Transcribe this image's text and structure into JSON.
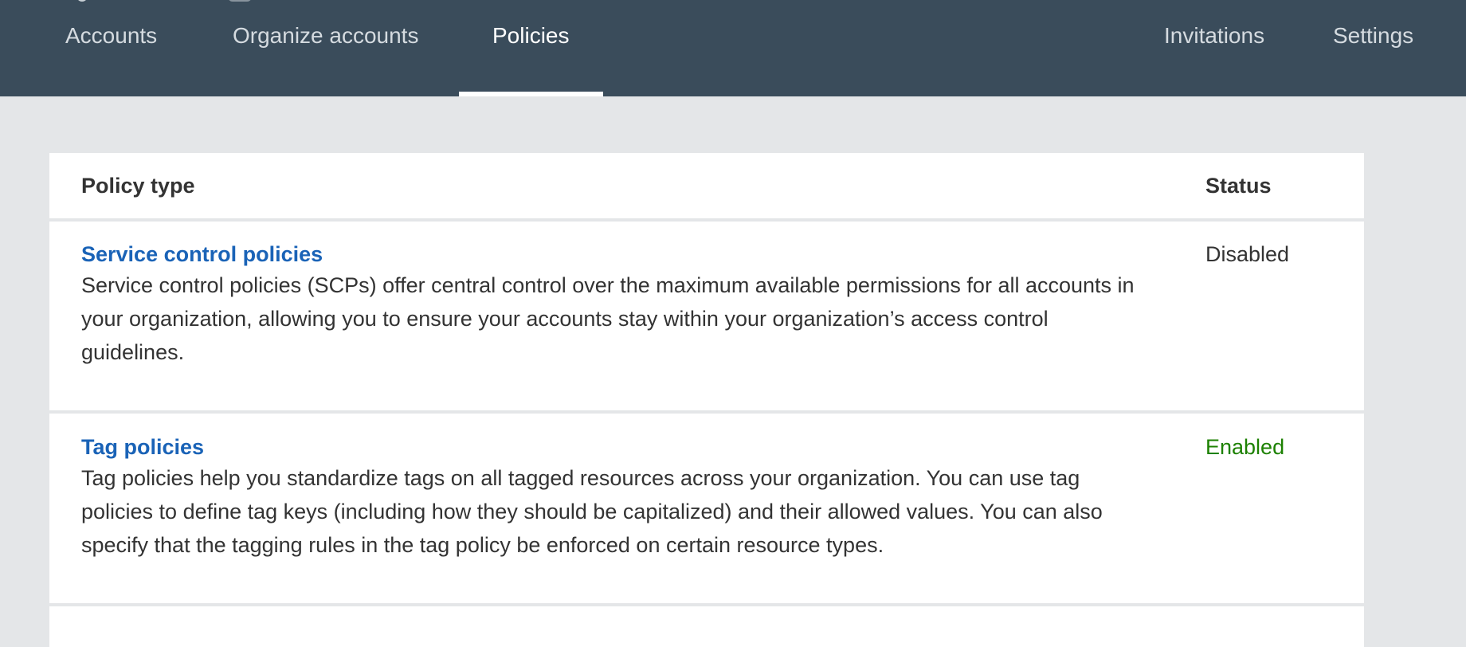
{
  "nav": {
    "tabs": [
      {
        "label": "Accounts",
        "active": false
      },
      {
        "label": "Organize accounts",
        "active": false
      },
      {
        "label": "Policies",
        "active": true
      },
      {
        "label": "Invitations",
        "active": false
      },
      {
        "label": "Settings",
        "active": false
      }
    ]
  },
  "table": {
    "columns": {
      "policy_type": "Policy type",
      "status": "Status"
    },
    "rows": [
      {
        "title": "Service control policies",
        "description": "Service control policies (SCPs) offer central control over the maximum available permissions for all accounts in your organization, allowing you to ensure your accounts stay within your organization’s access control guidelines.",
        "status": "Disabled"
      },
      {
        "title": "Tag policies",
        "description": "Tag policies help you standardize tags on all tagged resources across your organization. You can use tag policies to define tag keys (including how they should be capitalized) and their allowed values. You can also specify that the tagging rules in the tag policy be enforced on certain resource types.",
        "status": "Enabled"
      }
    ]
  },
  "colors": {
    "topbar": "#3a4c5b",
    "link": "#1a63b7",
    "enabled": "#1d8102",
    "background": "#e4e6e8"
  }
}
